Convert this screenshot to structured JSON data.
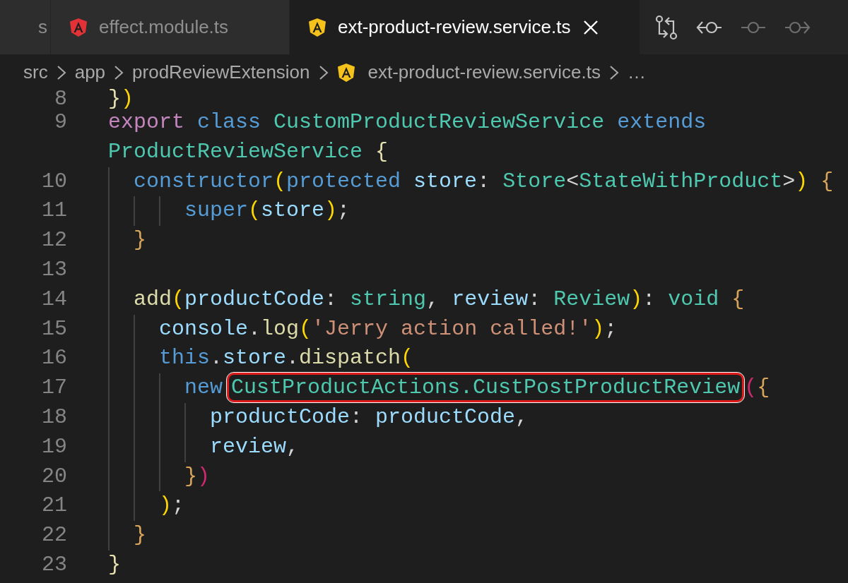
{
  "tabs": [
    {
      "label": "s",
      "selected": false
    },
    {
      "label": "effect.module.ts",
      "selected": false,
      "color": "#e23237"
    },
    {
      "label": "ext-product-review.service.ts",
      "selected": true,
      "color": "#f4c21b",
      "closable": true
    }
  ],
  "toolbar": [
    {
      "kind": "compare",
      "disabled": false
    },
    {
      "kind": "back",
      "disabled": false
    },
    {
      "kind": "commit",
      "disabled": true
    },
    {
      "kind": "forward",
      "disabled": true
    }
  ],
  "breadcrumb": [
    {
      "text": "src"
    },
    {
      "text": "app"
    },
    {
      "text": "prodReviewExtension"
    },
    {
      "text": "ext-product-review.service.ts",
      "color": "#f4c21b"
    },
    {
      "text": "…"
    }
  ],
  "lines": [
    {
      "number": "8",
      "tokens": [
        {
          "text": "}",
          "kind": "cream"
        },
        {
          "text": ")",
          "kind": "gold"
        }
      ]
    },
    {
      "number": "9",
      "tokens": [
        {
          "text": "export",
          "kind": "keyword2"
        },
        {
          "text": " class",
          "kind": "keyword"
        },
        {
          "text": " CustomProductReviewService",
          "kind": "type"
        },
        {
          "text": " extends",
          "kind": "keyword"
        }
      ]
    },
    {
      "tokens": [
        {
          "text": "ProductReviewService",
          "kind": "type"
        },
        {
          "text": " {",
          "kind": "cream"
        }
      ]
    },
    {
      "number": "10",
      "tokens": [
        {
          "text": "  constructor",
          "kind": "keyword"
        },
        {
          "text": "(",
          "kind": "gold"
        },
        {
          "text": "protected",
          "kind": "keyword"
        },
        {
          "text": " store",
          "kind": "variable"
        },
        {
          "text": ": ",
          "kind": "plain"
        },
        {
          "text": "Store",
          "kind": "type"
        },
        {
          "text": "<",
          "kind": "plain"
        },
        {
          "text": "StateWithProduct",
          "kind": "type"
        },
        {
          "text": ">",
          "kind": "plain"
        },
        {
          "text": ")",
          "kind": "gold"
        },
        {
          "text": " {",
          "kind": "orange"
        }
      ]
    },
    {
      "number": "11",
      "tokens": [
        {
          "text": "      super",
          "kind": "keyword"
        },
        {
          "text": "(",
          "kind": "gold"
        },
        {
          "text": "store",
          "kind": "variable"
        },
        {
          "text": ")",
          "kind": "gold"
        },
        {
          "text": ";",
          "kind": "plain"
        }
      ]
    },
    {
      "number": "12",
      "tokens": [
        {
          "text": "  }",
          "kind": "orange"
        }
      ]
    },
    {
      "number": "13"
    },
    {
      "number": "14",
      "tokens": [
        {
          "text": "  add",
          "kind": "function"
        },
        {
          "text": "(",
          "kind": "gold"
        },
        {
          "text": "productCode",
          "kind": "variable"
        },
        {
          "text": ": ",
          "kind": "plain"
        },
        {
          "text": "string",
          "kind": "type"
        },
        {
          "text": ", ",
          "kind": "plain"
        },
        {
          "text": "review",
          "kind": "variable"
        },
        {
          "text": ": ",
          "kind": "plain"
        },
        {
          "text": "Review",
          "kind": "type"
        },
        {
          "text": ")",
          "kind": "gold"
        },
        {
          "text": ": ",
          "kind": "plain"
        },
        {
          "text": "void",
          "kind": "type"
        },
        {
          "text": " {",
          "kind": "orange"
        }
      ]
    },
    {
      "number": "15",
      "tokens": [
        {
          "text": "    console",
          "kind": "variable"
        },
        {
          "text": ".",
          "kind": "plain"
        },
        {
          "text": "log",
          "kind": "function"
        },
        {
          "text": "(",
          "kind": "gold"
        },
        {
          "text": "'Jerry action called!'",
          "kind": "string"
        },
        {
          "text": ")",
          "kind": "gold"
        },
        {
          "text": ";",
          "kind": "plain"
        }
      ]
    },
    {
      "number": "16",
      "tokens": [
        {
          "text": "    this",
          "kind": "keyword"
        },
        {
          "text": ".",
          "kind": "plain"
        },
        {
          "text": "store",
          "kind": "variable"
        },
        {
          "text": ".",
          "kind": "plain"
        },
        {
          "text": "dispatch",
          "kind": "function"
        },
        {
          "text": "(",
          "kind": "gold"
        }
      ]
    },
    {
      "number": "17",
      "tokens": [
        {
          "text": "      new ",
          "kind": "keyword"
        },
        {
          "text": "CustProductActions.CustPostProductReview",
          "kind": "type",
          "highlighted": true
        },
        {
          "text": "(",
          "kind": "pink"
        },
        {
          "text": "{",
          "kind": "orange"
        }
      ]
    },
    {
      "number": "18",
      "tokens": [
        {
          "text": "        productCode",
          "kind": "variable"
        },
        {
          "text": ": ",
          "kind": "plain"
        },
        {
          "text": "productCode",
          "kind": "variable"
        },
        {
          "text": ",",
          "kind": "plain"
        }
      ]
    },
    {
      "number": "19",
      "tokens": [
        {
          "text": "        review",
          "kind": "variable"
        },
        {
          "text": ",",
          "kind": "plain"
        }
      ]
    },
    {
      "number": "20",
      "tokens": [
        {
          "text": "      }",
          "kind": "orange"
        },
        {
          "text": ")",
          "kind": "pink"
        }
      ]
    },
    {
      "number": "21",
      "tokens": [
        {
          "text": "    )",
          "kind": "gold"
        },
        {
          "text": ";",
          "kind": "plain"
        }
      ]
    },
    {
      "number": "22",
      "tokens": [
        {
          "text": "  }",
          "kind": "orange"
        }
      ]
    },
    {
      "number": "23",
      "tokens": [
        {
          "text": "}",
          "kind": "cream"
        }
      ]
    }
  ]
}
